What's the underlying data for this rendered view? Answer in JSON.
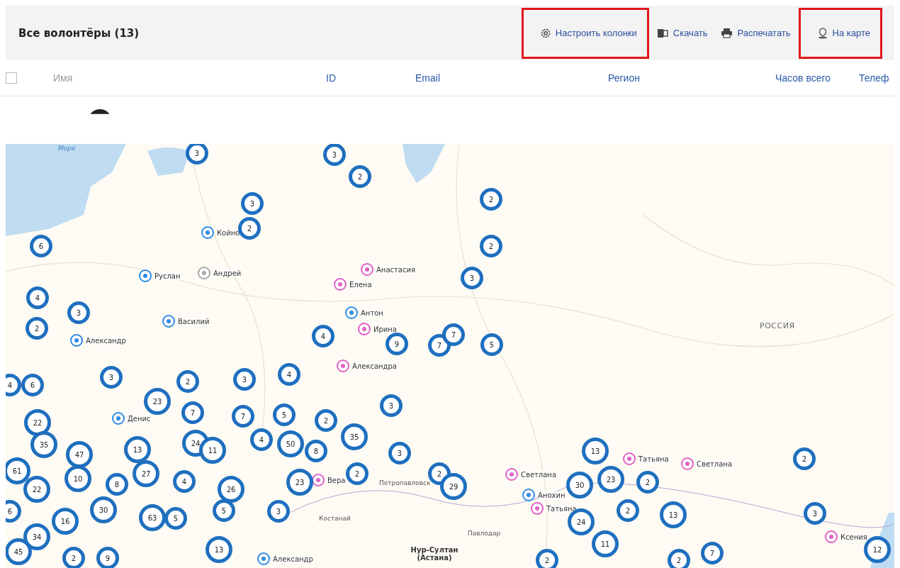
{
  "header": {
    "title": "Все волонтёры (13)",
    "actions": [
      {
        "label": "Настроить колонки",
        "highlighted": true
      },
      {
        "label": "Скачать",
        "highlighted": false
      },
      {
        "label": "Распечатать",
        "highlighted": false
      },
      {
        "label": "На карте",
        "highlighted": true
      }
    ]
  },
  "table": {
    "select_all": {
      "checked": false
    },
    "columns": [
      {
        "label": "Имя",
        "sortable": false
      },
      {
        "label": "ID",
        "sortable": true
      },
      {
        "label": "Email",
        "sortable": true
      },
      {
        "label": "Регион",
        "sortable": true
      },
      {
        "label": "Часов всего",
        "sortable": true
      },
      {
        "label": "Телеф",
        "sortable": true
      }
    ]
  },
  "map": {
    "labels": [
      {
        "text": "Море",
        "kind": "water"
      },
      {
        "text": "РОССИЯ",
        "kind": "country"
      },
      {
        "text": "Петропавловск",
        "kind": "city"
      },
      {
        "text": "Костанай",
        "kind": "city"
      },
      {
        "text": "Павлодар",
        "kind": "city"
      },
      {
        "text": "Нур-Султан (Астана)",
        "kind": "capital"
      }
    ],
    "clusters": [
      {
        "count": "3"
      },
      {
        "count": "3"
      },
      {
        "count": "2"
      },
      {
        "count": "3"
      },
      {
        "count": "2"
      },
      {
        "count": "2"
      },
      {
        "count": "6"
      },
      {
        "count": "2"
      },
      {
        "count": "3"
      },
      {
        "count": "4"
      },
      {
        "count": "3"
      },
      {
        "count": "2"
      },
      {
        "count": "4"
      },
      {
        "count": "9"
      },
      {
        "count": "7"
      },
      {
        "count": "7"
      },
      {
        "count": "5"
      },
      {
        "count": "4"
      },
      {
        "count": "6"
      },
      {
        "count": "3"
      },
      {
        "count": "2"
      },
      {
        "count": "3"
      },
      {
        "count": "4"
      },
      {
        "count": "23"
      },
      {
        "count": "7"
      },
      {
        "count": "7"
      },
      {
        "count": "5"
      },
      {
        "count": "2"
      },
      {
        "count": "3"
      },
      {
        "count": "22"
      },
      {
        "count": "35"
      },
      {
        "count": "35"
      },
      {
        "count": "47"
      },
      {
        "count": "13"
      },
      {
        "count": "24"
      },
      {
        "count": "11"
      },
      {
        "count": "4"
      },
      {
        "count": "50"
      },
      {
        "count": "8"
      },
      {
        "count": "3"
      },
      {
        "count": "13"
      },
      {
        "count": "61"
      },
      {
        "count": "10"
      },
      {
        "count": "8"
      },
      {
        "count": "27"
      },
      {
        "count": "4"
      },
      {
        "count": "22"
      },
      {
        "count": "26"
      },
      {
        "count": "23"
      },
      {
        "count": "2"
      },
      {
        "count": "2"
      },
      {
        "count": "29"
      },
      {
        "count": "30"
      },
      {
        "count": "23"
      },
      {
        "count": "2"
      },
      {
        "count": "2"
      },
      {
        "count": "6"
      },
      {
        "count": "30"
      },
      {
        "count": "63"
      },
      {
        "count": "5"
      },
      {
        "count": "5"
      },
      {
        "count": "3"
      },
      {
        "count": "24"
      },
      {
        "count": "2"
      },
      {
        "count": "13"
      },
      {
        "count": "3"
      },
      {
        "count": "16"
      },
      {
        "count": "34"
      },
      {
        "count": "45"
      },
      {
        "count": "2"
      },
      {
        "count": "9"
      },
      {
        "count": "13"
      },
      {
        "count": "11"
      },
      {
        "count": "2"
      },
      {
        "count": "2"
      },
      {
        "count": "7"
      },
      {
        "count": "12"
      }
    ],
    "volunteers": [
      {
        "name": "Койно",
        "color": "#2e8ae6"
      },
      {
        "name": "Руслан",
        "color": "#2e8ae6"
      },
      {
        "name": "Андрей",
        "color": "#a8a8a8"
      },
      {
        "name": "Анастасия",
        "color": "#e060c8"
      },
      {
        "name": "Елена",
        "color": "#e060c8"
      },
      {
        "name": "Антон",
        "color": "#2e8ae6"
      },
      {
        "name": "Ирина",
        "color": "#e060c8"
      },
      {
        "name": "Василий",
        "color": "#2e8ae6"
      },
      {
        "name": "Александр",
        "color": "#2e8ae6"
      },
      {
        "name": "Александра",
        "color": "#e060c8"
      },
      {
        "name": "Денис",
        "color": "#2e8ae6"
      },
      {
        "name": "Вера",
        "color": "#e060c8"
      },
      {
        "name": "Светлана",
        "color": "#e060c8"
      },
      {
        "name": "Анохин",
        "color": "#2e8ae6"
      },
      {
        "name": "Татьяна",
        "color": "#e060c8"
      },
      {
        "name": "Татьяна",
        "color": "#e060c8"
      },
      {
        "name": "Светлана",
        "color": "#e060c8"
      },
      {
        "name": "Ксения",
        "color": "#e060c8"
      },
      {
        "name": "Александр",
        "color": "#2e8ae6"
      }
    ]
  }
}
